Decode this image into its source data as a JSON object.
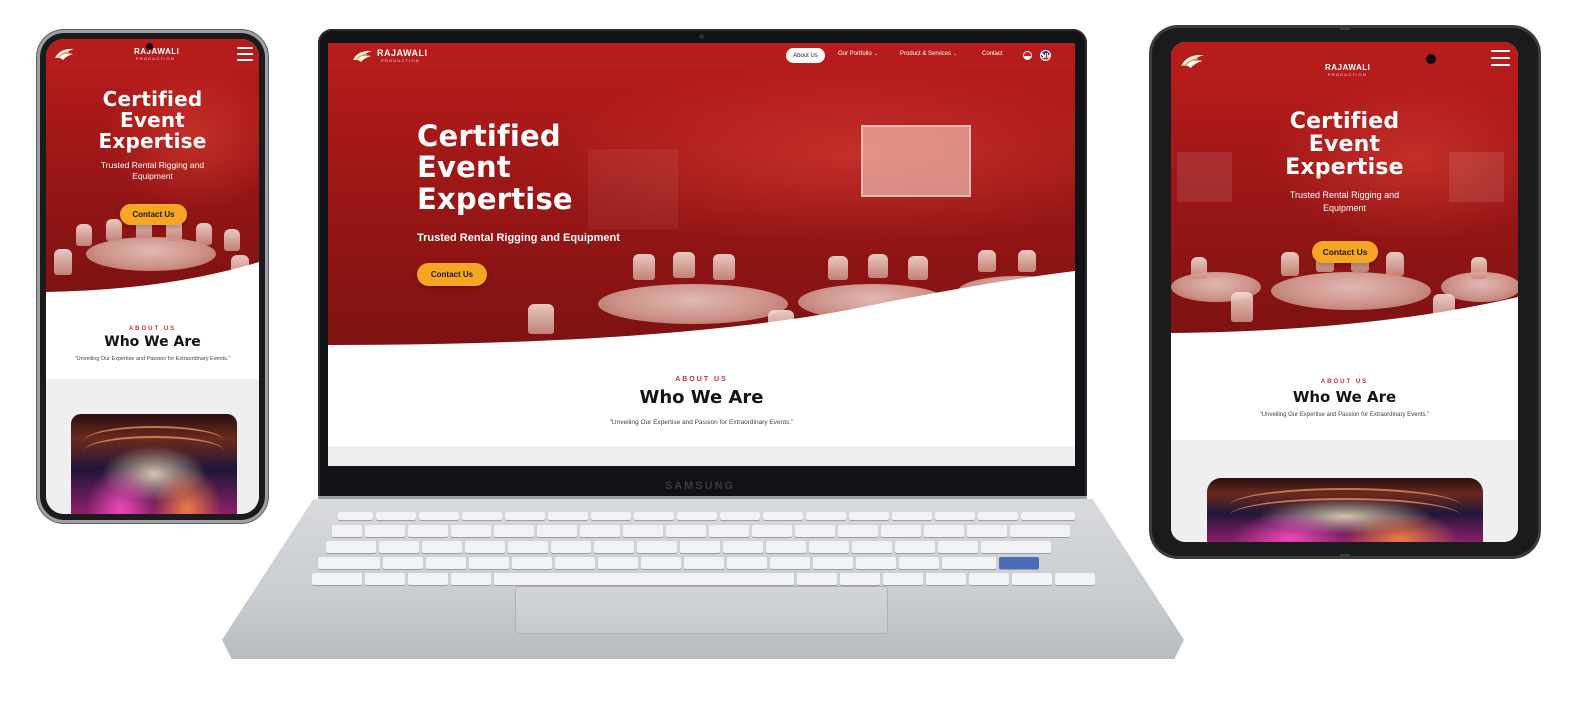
{
  "site": {
    "brand": "RAJAWALI",
    "brand_sub": "PRODUCTION",
    "nav": [
      {
        "label": "About Us",
        "active": true
      },
      {
        "label": "Our Portfolio",
        "dropdown": true
      },
      {
        "label": "Product & Services",
        "dropdown": true
      },
      {
        "label": "Contact"
      }
    ],
    "languages": [
      "Indonesian",
      "English"
    ],
    "hero": {
      "title_line1": "Certified",
      "title_line2": "Event",
      "title_line3": "Expertise",
      "subtitle": "Trusted Rental Rigging and Equipment",
      "subtitle_line1": "Trusted Rental Rigging and",
      "subtitle_line2": "Equipment",
      "cta_label": "Contact Us"
    },
    "about": {
      "label": "ABOUT US",
      "title": "Who We Are",
      "quote": "\"Unveiling Our Expertise and Passion for Extraordinary Events.\""
    }
  },
  "devices": {
    "laptop_brand": "SAMSUNG"
  },
  "colors": {
    "primary_red": "#b31b1b",
    "accent_orange": "#f6a623",
    "about_label_red": "#d62a2a",
    "white": "#ffffff"
  },
  "icons": {
    "logo": "eagle-logo-icon",
    "menu": "hamburger-menu-icon",
    "chevron": "chevron-down-icon",
    "flag_id": "indonesia-flag-icon",
    "flag_uk": "uk-flag-icon"
  }
}
